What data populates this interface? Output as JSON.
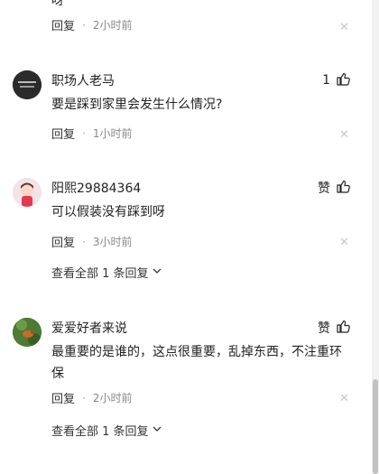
{
  "top_clip_text": "呀",
  "comments": [
    {
      "name": "",
      "likes": "",
      "text": "",
      "reply_label": "回复",
      "time": "2小时前"
    },
    {
      "name": "职场人老马",
      "likes": "1",
      "text": "要是踩到家里会发生什么情况?",
      "reply_label": "回复",
      "time": "1小时前"
    },
    {
      "name": "阳熙29884364",
      "likes": "赞",
      "text": "可以假装没有踩到呀",
      "reply_label": "回复",
      "time": "3小时前",
      "view_all": "查看全部 1 条回复"
    },
    {
      "name": "爱爱好者来说",
      "likes": "赞",
      "text": "最重要的是谁的，这点很重要，乱掉东西，不注重环保",
      "reply_label": "回复",
      "time": "2小时前",
      "view_all": "查看全部 1 条回复"
    }
  ],
  "dot": "·",
  "icons": {
    "like": "thumbs-up-icon",
    "close": "close-icon",
    "chevron": "chevron-down-icon"
  },
  "colors": {
    "text": "#222222",
    "meta": "#888888",
    "close": "#c8c8c8"
  }
}
